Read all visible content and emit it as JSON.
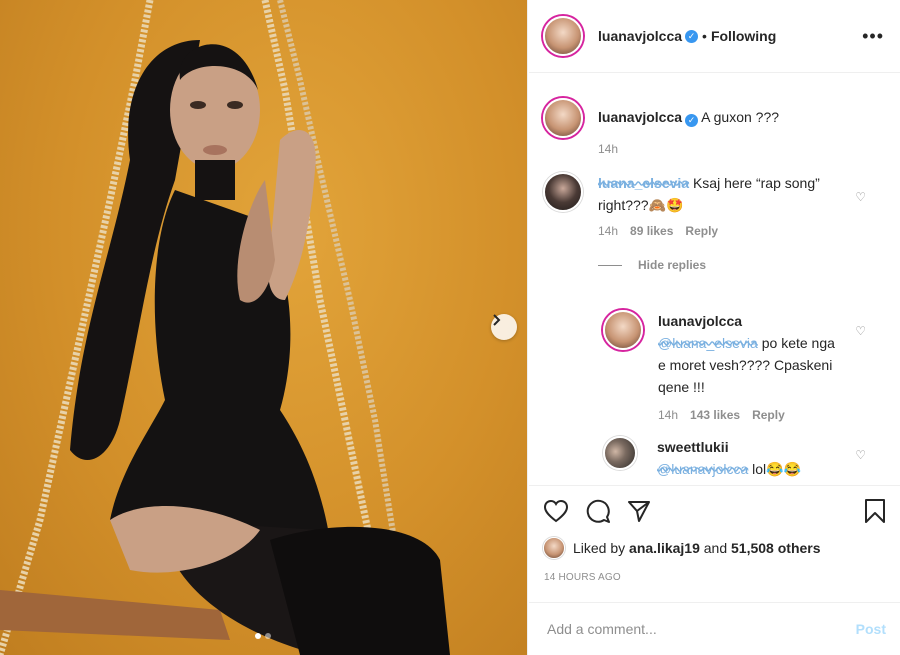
{
  "post": {
    "owner": "luanavjolcca",
    "follow_status": "Following",
    "more_icon": "more-horizontal-icon"
  },
  "caption": {
    "username": "luanavjolcca",
    "text": "A guxon ???",
    "time": "14h"
  },
  "comments": [
    {
      "username_scribbled": "luana_elsevia",
      "text": "Ksaj here “rap song” right???🙈🤩",
      "time": "14h",
      "likes": "89 likes",
      "reply": "Reply",
      "hide_replies": "Hide replies"
    }
  ],
  "replies": [
    {
      "username": "luanavjolcca",
      "mention_scribbled": "@luana_elsevia",
      "text": "po kete nga e moret vesh???? Cpaskeni qene !!!",
      "time": "14h",
      "likes": "143 likes",
      "reply": "Reply"
    },
    {
      "username": "sweettlukii",
      "mention_scribbled": "@luanavjolcca",
      "text": "lol😂😂"
    }
  ],
  "likes_summary": {
    "prefix": "Liked by",
    "user": "ana.likaj19",
    "middle": "and",
    "count": "51,508 others"
  },
  "timestamp": "14 HOURS AGO",
  "add_comment": {
    "placeholder": "Add a comment...",
    "post_label": "Post"
  },
  "carousel": {
    "slides": 2,
    "active": 0
  },
  "colors": {
    "background_photo": "#d3902a",
    "verified": "#3897f0",
    "post_disabled": "#b2dffc",
    "story_ring": "#d6249f"
  }
}
